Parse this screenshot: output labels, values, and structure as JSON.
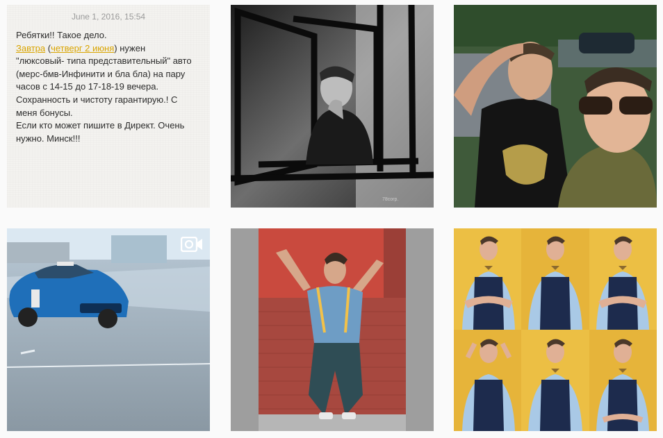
{
  "note": {
    "date": "June 1, 2016, 15:54",
    "lines": {
      "l1": "Ребятки!! Такое дело.",
      "l2_link1": "Завтра",
      "l2_p1": " (",
      "l2_link2": "четверг 2 июня",
      "l2_p2": ") нужен",
      "l3": "\"люксовый- типа представительный\" авто",
      "l4": "(мерс-бмв-Инфинити и бла бла) на пару",
      "l5": "часов с 14-15 до 17-18-19 вечера.",
      "l6": "Сохранность и чистоту гарантирую.! С",
      "l7": "меня бонусы.",
      "l8": "Если кто может пишите в Директ. Очень",
      "l9": "нужно. Минск!!!"
    }
  },
  "photos": {
    "p2": {
      "watermark": "78corp."
    }
  },
  "icons": {
    "video": "video-camera-icon"
  }
}
